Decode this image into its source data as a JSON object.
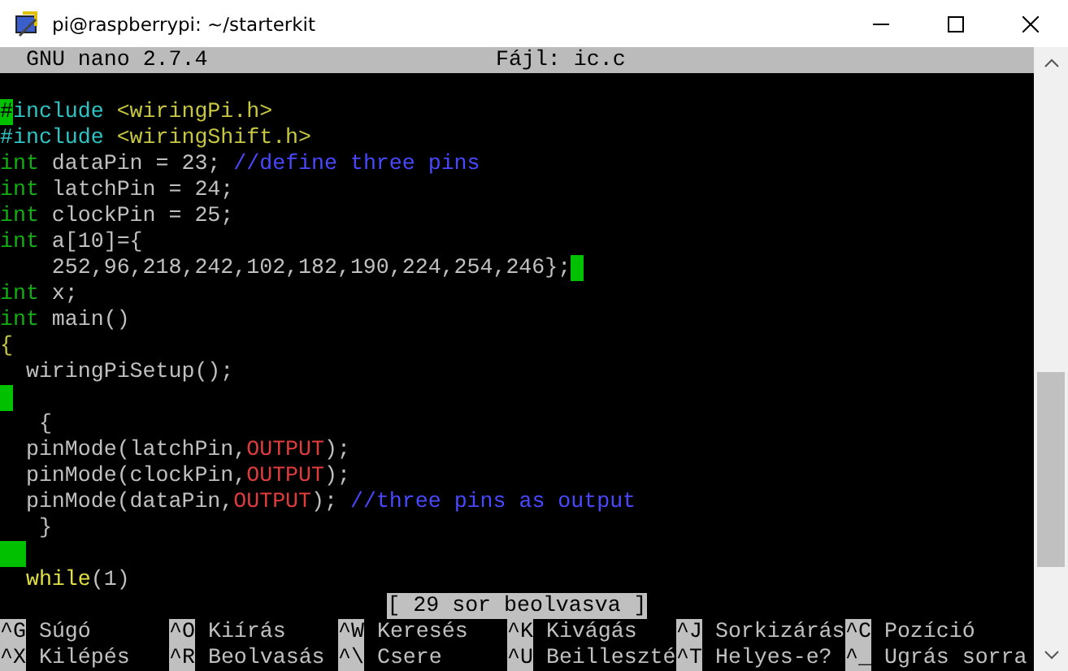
{
  "window": {
    "title": "pi@raspberrypi: ~/starterkit"
  },
  "header": {
    "version": "GNU nano 2.7.4",
    "file": "Fájl: ic.c"
  },
  "lines": [
    [
      {
        "kind": "cursor",
        "text": "#"
      },
      {
        "kind": "directive",
        "text": "include"
      },
      {
        "kind": "header",
        "text": " <wiringPi.h>"
      }
    ],
    [
      {
        "kind": "directive",
        "text": "#include"
      },
      {
        "kind": "header",
        "text": " <wiringShift.h>"
      }
    ],
    [
      {
        "kind": "keyword",
        "text": "int"
      },
      {
        "kind": "plain",
        "text": " dataPin = 23; "
      },
      {
        "kind": "comment",
        "text": "//define three pins"
      }
    ],
    [
      {
        "kind": "keyword",
        "text": "int"
      },
      {
        "kind": "plain",
        "text": " latchPin = 24;"
      }
    ],
    [
      {
        "kind": "keyword",
        "text": "int"
      },
      {
        "kind": "plain",
        "text": " clockPin = 25;"
      }
    ],
    [
      {
        "kind": "keyword",
        "text": "int"
      },
      {
        "kind": "plain",
        "text": " a[10]={"
      }
    ],
    [
      {
        "kind": "plain",
        "text": "    252,96,218,242,102,182,190,224,254,246};"
      },
      {
        "kind": "trailing-space",
        "wide": false
      }
    ],
    [
      {
        "kind": "keyword",
        "text": "int"
      },
      {
        "kind": "plain",
        "text": " x;"
      }
    ],
    [
      {
        "kind": "keyword",
        "text": "int"
      },
      {
        "kind": "plain",
        "text": " main()"
      }
    ],
    [
      {
        "kind": "brace",
        "text": "{"
      }
    ],
    [
      {
        "kind": "plain",
        "text": "  wiringPiSetup();"
      }
    ],
    [
      {
        "kind": "trailing-space",
        "wide": false
      }
    ],
    [
      {
        "kind": "plain",
        "text": "   {"
      }
    ],
    [
      {
        "kind": "plain",
        "text": "  pinMode(latchPin,"
      },
      {
        "kind": "constant",
        "text": "OUTPUT"
      },
      {
        "kind": "plain",
        "text": ");"
      }
    ],
    [
      {
        "kind": "plain",
        "text": "  pinMode(clockPin,"
      },
      {
        "kind": "constant",
        "text": "OUTPUT"
      },
      {
        "kind": "plain",
        "text": ");"
      }
    ],
    [
      {
        "kind": "plain",
        "text": "  pinMode(dataPin,"
      },
      {
        "kind": "constant",
        "text": "OUTPUT"
      },
      {
        "kind": "plain",
        "text": "); "
      },
      {
        "kind": "comment",
        "text": "//three pins as output"
      }
    ],
    [
      {
        "kind": "plain",
        "text": "   }"
      }
    ],
    [
      {
        "kind": "trailing-space",
        "wide": true
      }
    ],
    [
      {
        "kind": "keyword-loop",
        "text": "  while"
      },
      {
        "kind": "plain",
        "text": "(1)"
      }
    ]
  ],
  "status": "[ 29 sor beolvasva ]",
  "shortcuts": [
    [
      {
        "key": "^G",
        "label": "Súgó"
      },
      {
        "key": "^O",
        "label": "Kiírás"
      },
      {
        "key": "^W",
        "label": "Keresés"
      },
      {
        "key": "^K",
        "label": "Kivágás"
      },
      {
        "key": "^J",
        "label": "Sorkizárás"
      },
      {
        "key": "^C",
        "label": "Pozíció"
      }
    ],
    [
      {
        "key": "^X",
        "label": "Kilépés"
      },
      {
        "key": "^R",
        "label": "Beolvasás"
      },
      {
        "key": "^\\",
        "label": "Csere"
      },
      {
        "key": "^U",
        "label": "Beilleszté"
      },
      {
        "key": "^T",
        "label": "Helyes-e?"
      },
      {
        "key": "^_",
        "label": "Ugrás sorra"
      }
    ]
  ]
}
